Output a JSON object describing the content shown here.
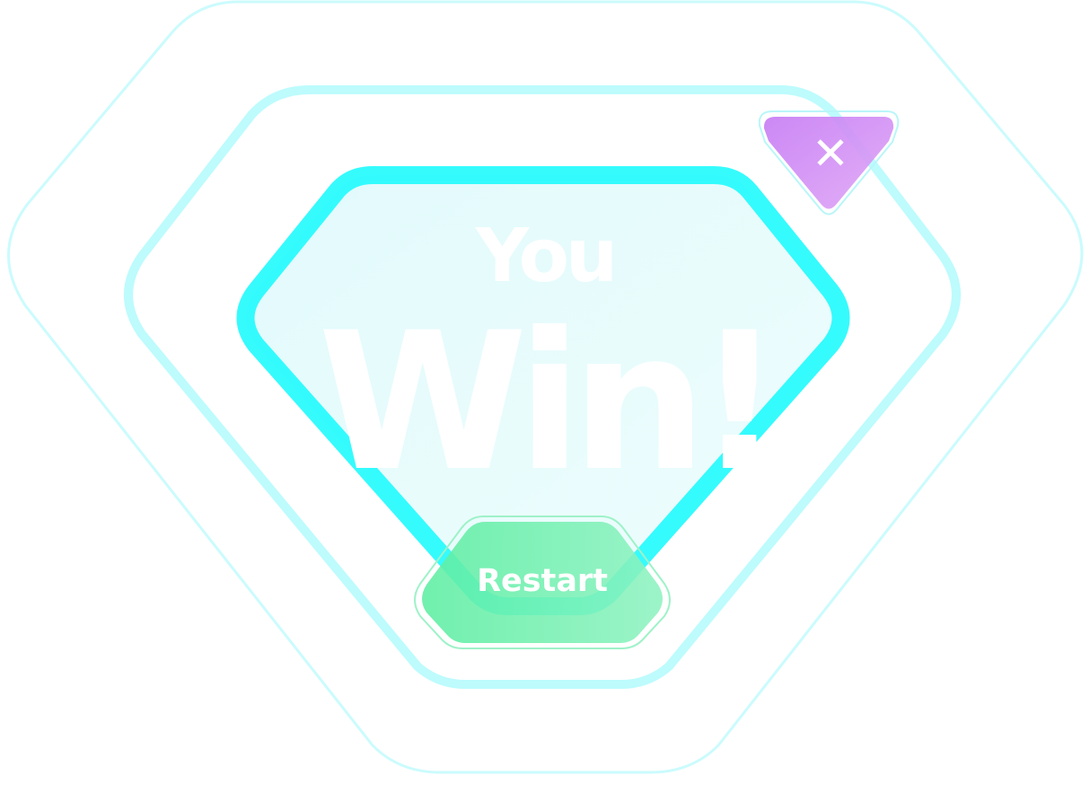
{
  "dialog": {
    "title_line1": "You",
    "title_line2": "Win!"
  },
  "buttons": {
    "restart_label": "Restart",
    "close_glyph": "✕",
    "close_icon": "close-icon"
  },
  "colors": {
    "outer_ring": "#cbfbfd",
    "middle_ring": "#bdfbfd",
    "inner_ring": "#24fbfd",
    "panel_fill": "#e4fbfc",
    "restart_button": "#67eea8",
    "close_button": "#c98af8"
  }
}
